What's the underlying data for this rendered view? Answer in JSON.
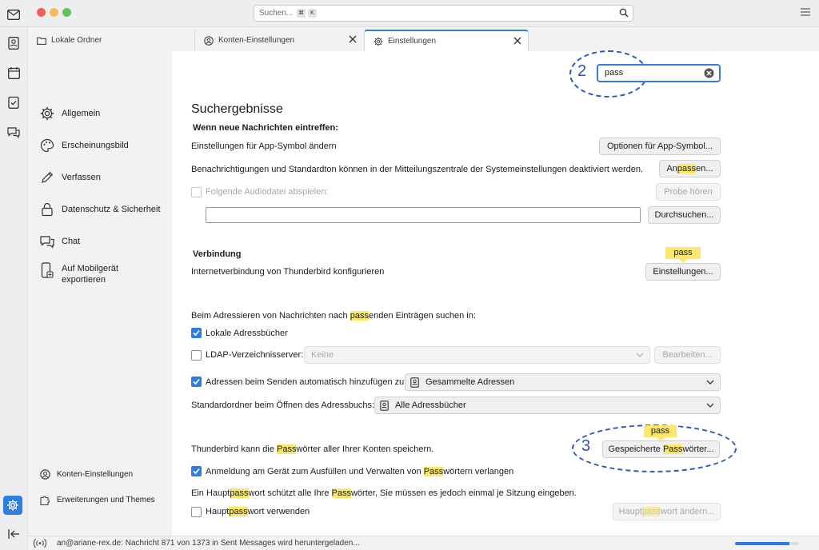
{
  "global_search": {
    "placeholder": "Suchen...",
    "key1": "⌘",
    "key2": "K"
  },
  "tabs": [
    {
      "label": "Lokale Ordner",
      "icon": "folder-icon"
    },
    {
      "label": "Konten-Einstellungen",
      "icon": "account-settings-icon"
    },
    {
      "label": "Einstellungen",
      "icon": "gear-icon"
    }
  ],
  "sidebar": {
    "categories": [
      {
        "label": "Allgemein",
        "icon": "gear-icon"
      },
      {
        "label": "Erscheinungsbild",
        "icon": "paint-icon"
      },
      {
        "label": "Verfassen",
        "icon": "pencil-icon"
      },
      {
        "label": "Datenschutz & Sicherheit",
        "icon": "lock-icon"
      },
      {
        "label": "Chat",
        "icon": "chat-icon"
      },
      {
        "label_line1": "Auf Mobilgerät",
        "label_line2": "exportieren",
        "icon": "mobile-export-icon"
      }
    ],
    "bottom": [
      {
        "label": "Konten-Einstellungen",
        "icon": "account-settings-icon"
      },
      {
        "label": "Erweiterungen und Themes",
        "icon": "puzzle-icon"
      }
    ]
  },
  "prefs_search": {
    "value": "pass"
  },
  "annotations": {
    "num2": "2",
    "num3": "3"
  },
  "main": {
    "heading": "Suchergebnisse",
    "new_messages": {
      "title": "Wenn neue Nachrichten eintreffen:",
      "app_icon_text": "Einstellungen für App-Symbol ändern",
      "app_icon_button": "Optionen für App-Symbol...",
      "notif_text": "Benachrichtigungen und Standardton können in der Mitteilungszentrale der Systemeinstellungen deaktiviert werden.",
      "customize_pre": "An",
      "customize_hl": "pass",
      "customize_post": "en...",
      "audio_label": "Folgende Audiodatei abspielen:",
      "probe_button": "Probe hören",
      "browse_button": "Durchsuchen..."
    },
    "connection": {
      "title": "Verbindung",
      "tag": "pass",
      "text": "Internetverbindung von Thunderbird konfigurieren",
      "button": "Einstellungen..."
    },
    "addressing": {
      "intro_pre": "Beim Adressieren von Nachrichten nach ",
      "intro_hl": "pass",
      "intro_post": "enden Einträgen suchen in:",
      "local_books": "Lokale Adressbücher",
      "ldap_label": "LDAP-Verzeichnisserver:",
      "ldap_value": "Keine",
      "edit_button": "Bearbeiten...",
      "auto_add_label": "Adressen beim Senden automatisch hinzufügen zu:",
      "auto_add_value": "Gesammelte Adressen",
      "default_folder_label": "Standardordner beim Öffnen des Adressbuchs:",
      "default_folder_value": "Alle Adressbücher"
    },
    "passwords": {
      "tag": "pass",
      "text_pre": "Thunderbird kann die ",
      "text_hl": "Pass",
      "text_post": "wörter aller Ihrer Konten speichern.",
      "saved_pre": "Gespeicherte ",
      "saved_hl": "Pass",
      "saved_post": "wörter...",
      "device_pre": "Anmeldung am Gerät zum Ausfüllen und Verwalten von ",
      "device_hl": "Pass",
      "device_post": "wörtern verlangen",
      "master_a": "Ein Haupt",
      "master_b": "pass",
      "master_c": "wort schützt alle Ihre ",
      "master_d": "Pass",
      "master_e": "wörter, Sie müssen es jedoch einmal je Sitzung eingeben.",
      "use_master_pre": "Haupt",
      "use_master_hl": "pass",
      "use_master_post": "wort verwenden",
      "change_master_pre": "Haupt",
      "change_master_hl": "pass",
      "change_master_post": "wort ändern..."
    }
  },
  "status": {
    "text": "an@ariane-rex.de: Nachricht 871 von 1373 in Sent Messages wird heruntergeladen...",
    "progress": 0.85
  },
  "colors": {
    "accent": "#2f7de1",
    "highlight": "#fbe76b",
    "annotation": "#2d52c4"
  }
}
